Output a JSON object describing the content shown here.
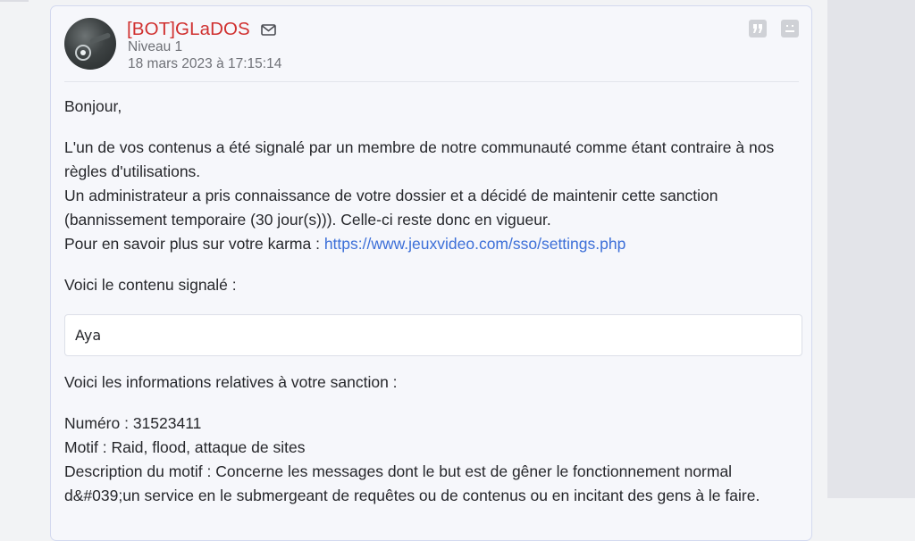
{
  "post": {
    "author": "[BOT]GLaDOS",
    "level": "Niveau 1",
    "date": "18 mars 2023 à 17:15:14"
  },
  "body": {
    "greeting": "Bonjour,",
    "para1_line1": "L'un de vos contenus a été signalé par un membre de notre communauté comme étant contraire à nos",
    "para1_line2": "règles d'utilisations.",
    "para1_line3": "Un administrateur a pris connaissance de votre dossier et a décidé de maintenir cette sanction",
    "para1_line4": "(bannissement temporaire (30 jour(s))). Celle-ci reste donc en vigueur.",
    "karma_prefix": "Pour en savoir plus sur votre karma : ",
    "karma_link": "https://www.jeuxvideo.com/sso/settings.php",
    "reported_intro": "Voici le contenu signalé :",
    "quoted_content": "Aya",
    "sanction_intro": "Voici les informations relatives à votre sanction :",
    "numero": "Numéro : 31523411",
    "motif": "Motif : Raid, flood, attaque de sites",
    "description_line1": "Description du motif : Concerne les messages dont le but est de gêner le fonctionnement normal",
    "description_line2": "d&#039;un service en le submergeant de requêtes ou de contenus ou en incitant des gens à le faire."
  },
  "colors": {
    "author": "#d0302f",
    "link": "#3c6fd8",
    "card_background": "#f6f7fb",
    "card_border": "#d3d9ef"
  },
  "icons": {
    "mail": "mail-icon",
    "quote": "quote-icon",
    "report": "report-icon"
  }
}
